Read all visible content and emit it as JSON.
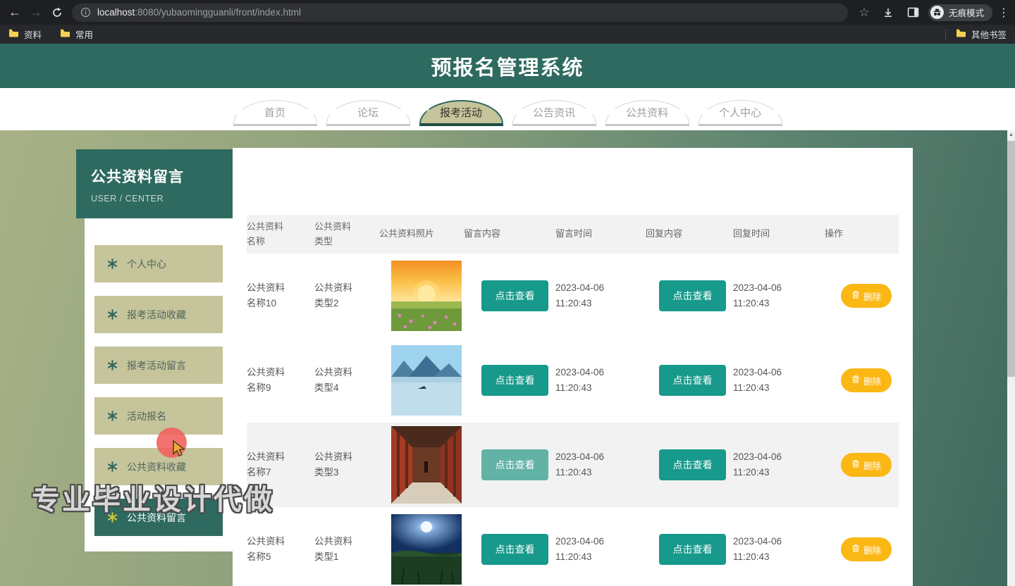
{
  "browser": {
    "url": {
      "host": "localhost",
      "path": ":8080/yubaomingguanli/front/index.html"
    },
    "incognito_label": "无痕模式",
    "bookmarks": [
      {
        "label": "资料"
      },
      {
        "label": "常用"
      }
    ],
    "other_bookmarks_label": "其他书签"
  },
  "icons": {
    "back": "←",
    "forward": "→",
    "star": "☆",
    "menu_dots": "⋮",
    "scroll_up": "▲"
  },
  "header": {
    "title": "预报名管理系统"
  },
  "nav": {
    "tabs": [
      {
        "label": "首页",
        "active": false
      },
      {
        "label": "论坛",
        "active": false
      },
      {
        "label": "报考活动",
        "active": true
      },
      {
        "label": "公告资讯",
        "active": false
      },
      {
        "label": "公共资料",
        "active": false
      },
      {
        "label": "个人中心",
        "active": false
      }
    ]
  },
  "sidebar": {
    "title": "公共资料留言",
    "subtitle": "USER / CENTER",
    "items": [
      {
        "label": "个人中心",
        "active": false
      },
      {
        "label": "报考活动收藏",
        "active": false
      },
      {
        "label": "报考活动留言",
        "active": false
      },
      {
        "label": "活动报名",
        "active": false
      },
      {
        "label": "公共资料收藏",
        "active": false
      },
      {
        "label": "公共资料留言",
        "active": true
      }
    ]
  },
  "table": {
    "headers": [
      "公共资料\n名称",
      "公共资料\n类型",
      "公共资料照片",
      "留言内容",
      "留言时间",
      "回复内容",
      "回复时间",
      "操作"
    ],
    "view_button_label": "点击查看",
    "delete_button_label": "删除",
    "rows": [
      {
        "name": "公共资料\n名称10",
        "type": "公共资料\n类型2",
        "photo": "sunset-meadow-photo",
        "message_time": "2023-04-06\n11:20:43",
        "reply_time": "2023-04-06\n11:20:43",
        "striped": false,
        "view_hover": false
      },
      {
        "name": "公共资料\n名称9",
        "type": "公共资料\n类型4",
        "photo": "lake-mountains-photo",
        "message_time": "2023-04-06\n11:20:43",
        "reply_time": "2023-04-06\n11:20:43",
        "striped": false,
        "view_hover": false
      },
      {
        "name": "公共资料\n名称7",
        "type": "公共资料\n类型3",
        "photo": "red-corridor-photo",
        "message_time": "2023-04-06\n11:20:43",
        "reply_time": "2023-04-06\n11:20:43",
        "striped": true,
        "view_hover": true
      },
      {
        "name": "公共资料\n名称5",
        "type": "公共资料\n类型1",
        "photo": "moonlit-field-photo",
        "message_time": "2023-04-06\n11:20:43",
        "reply_time": "2023-04-06\n11:20:43",
        "striped": false,
        "view_hover": false
      }
    ]
  },
  "watermark": "专业毕业设计代做",
  "colors": {
    "accent_teal": "#2E6A5F",
    "tab_active_fill": "#C5C49A",
    "menu_item_fill": "#C5C49B",
    "view_button": "#17998B",
    "view_button_light": "#63B2A6",
    "delete_button": "#FBB714",
    "stripe": "#F2F2F2",
    "bg_olive": "#A9B286",
    "bg_teal": "#3F685D"
  }
}
